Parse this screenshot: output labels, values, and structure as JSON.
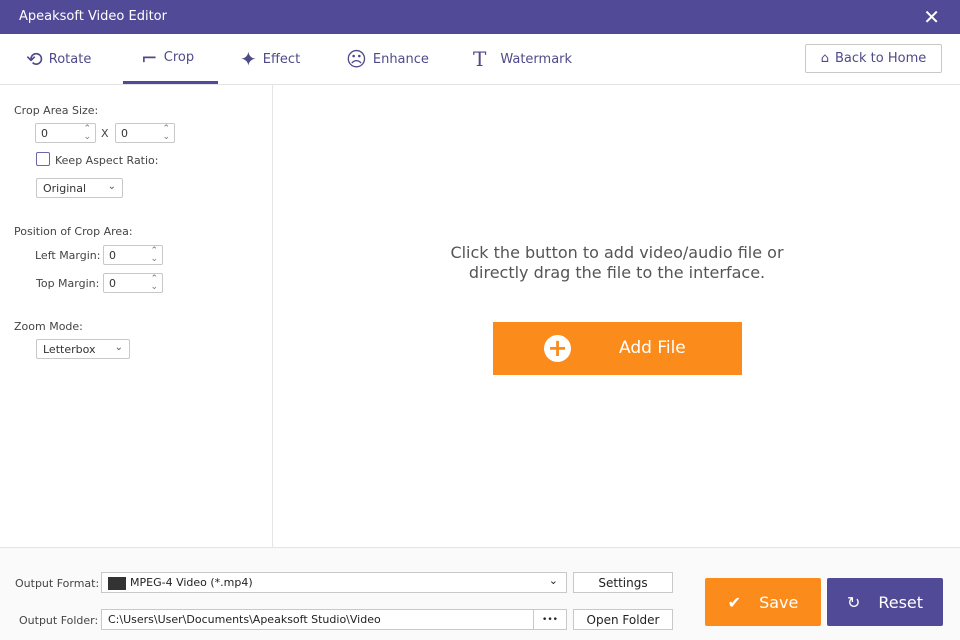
{
  "window": {
    "title": "Apeaksoft Video Editor"
  },
  "tabs": [
    {
      "label": "Rotate"
    },
    {
      "label": "Crop"
    },
    {
      "label": "Effect"
    },
    {
      "label": "Enhance"
    },
    {
      "label": "Watermark"
    }
  ],
  "back_home": "Back to Home",
  "crop": {
    "size_label": "Crop Area Size:",
    "width": "0",
    "x": "X",
    "height": "0",
    "keep_aspect": "Keep Aspect Ratio:",
    "aspect": "Original",
    "position_label": "Position of Crop Area:",
    "left_margin_label": "Left Margin:",
    "left_margin": "0",
    "top_margin_label": "Top Margin:",
    "top_margin": "0",
    "zoom_label": "Zoom Mode:",
    "zoom": "Letterbox"
  },
  "main": {
    "line1": "Click the button to add video/audio file or",
    "line2": "directly drag the file to the interface.",
    "add_file": "Add File"
  },
  "output": {
    "format_label": "Output Format:",
    "format": "MPEG-4 Video (*.mp4)",
    "settings": "Settings",
    "folder_label": "Output Folder:",
    "folder": "C:\\Users\\User\\Documents\\Apeaksoft Studio\\Video",
    "browse": "•••",
    "open_folder": "Open Folder"
  },
  "actions": {
    "save": "Save",
    "reset": "Reset"
  },
  "colors": {
    "accent": "#514a96",
    "orange": "#fb8c1b"
  }
}
